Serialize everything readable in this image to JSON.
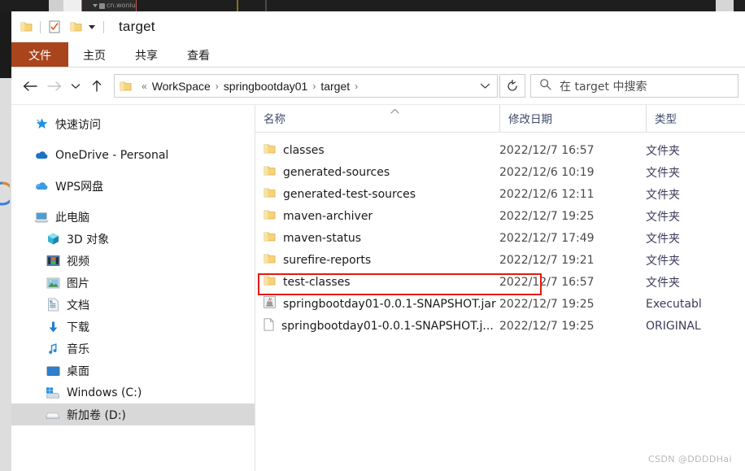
{
  "ide_background": {
    "tab_label": "cn.woniu",
    "tab_caret_icon": "chevron-down-icon",
    "package_icon": "package-icon",
    "bg_color": "#1e1e1e",
    "tab_border_color": "#c9534f",
    "accent_color": "#8a6d22"
  },
  "window": {
    "title": "target",
    "quick_access": {
      "folder_icon": "folder-icon",
      "properties_icon": "properties-checkbox-icon",
      "new_folder_icon": "new-folder-icon",
      "customize_icon": "chevron-down-icon"
    },
    "ribbon": {
      "tabs": [
        {
          "label": "文件",
          "active": true
        },
        {
          "label": "主页",
          "active": false
        },
        {
          "label": "共享",
          "active": false
        },
        {
          "label": "查看",
          "active": false
        }
      ],
      "file_tab_color": "#a9441c"
    },
    "navbar": {
      "back_icon": "arrow-left-icon",
      "forward_icon": "arrow-right-icon",
      "recent_icon": "chevron-down-icon",
      "up_icon": "arrow-up-icon",
      "address": {
        "folder_icon": "folder-icon",
        "overflow": "«",
        "crumbs": [
          "WorkSpace",
          "springbootday01",
          "target"
        ],
        "separator": "›",
        "dropdown_icon": "chevron-down-icon"
      },
      "refresh_icon": "refresh-icon",
      "search": {
        "icon": "search-icon",
        "placeholder": "在 target 中搜索",
        "value": ""
      }
    }
  },
  "sidebar": {
    "items": [
      {
        "label": "快速访问",
        "icon": "star-pin-icon",
        "indent": 0,
        "gap_top": false,
        "selected": false
      },
      {
        "label": "OneDrive - Personal",
        "icon": "onedrive-cloud-icon",
        "indent": 0,
        "gap_top": true,
        "selected": false
      },
      {
        "label": "WPS网盘",
        "icon": "wps-cloud-icon",
        "indent": 0,
        "gap_top": true,
        "selected": false
      },
      {
        "label": "此电脑",
        "icon": "this-pc-icon",
        "indent": 0,
        "gap_top": true,
        "selected": false
      },
      {
        "label": "3D 对象",
        "icon": "3d-objects-icon",
        "indent": 1,
        "gap_top": false,
        "selected": false
      },
      {
        "label": "视频",
        "icon": "videos-icon",
        "indent": 1,
        "gap_top": false,
        "selected": false
      },
      {
        "label": "图片",
        "icon": "pictures-icon",
        "indent": 1,
        "gap_top": false,
        "selected": false
      },
      {
        "label": "文档",
        "icon": "documents-icon",
        "indent": 1,
        "gap_top": false,
        "selected": false
      },
      {
        "label": "下载",
        "icon": "downloads-icon",
        "indent": 1,
        "gap_top": false,
        "selected": false
      },
      {
        "label": "音乐",
        "icon": "music-icon",
        "indent": 1,
        "gap_top": false,
        "selected": false
      },
      {
        "label": "桌面",
        "icon": "desktop-icon",
        "indent": 1,
        "gap_top": false,
        "selected": false
      },
      {
        "label": "Windows (C:)",
        "icon": "windows-drive-icon",
        "indent": 1,
        "gap_top": false,
        "selected": false
      },
      {
        "label": "新加卷 (D:)",
        "icon": "drive-icon",
        "indent": 1,
        "gap_top": false,
        "selected": true
      }
    ]
  },
  "filelist": {
    "columns": [
      {
        "label": "名称",
        "sorted": "asc",
        "sort_icon": "caret-up-icon"
      },
      {
        "label": "修改日期",
        "sorted": "",
        "sort_icon": ""
      },
      {
        "label": "类型",
        "sorted": "",
        "sort_icon": ""
      }
    ],
    "rows": [
      {
        "name": "classes",
        "date": "2022/12/7 16:57",
        "type": "文件夹",
        "icon": "folder-icon",
        "highlighted": false
      },
      {
        "name": "generated-sources",
        "date": "2022/12/6 10:19",
        "type": "文件夹",
        "icon": "folder-icon",
        "highlighted": false
      },
      {
        "name": "generated-test-sources",
        "date": "2022/12/6 12:11",
        "type": "文件夹",
        "icon": "folder-icon",
        "highlighted": false
      },
      {
        "name": "maven-archiver",
        "date": "2022/12/7 19:25",
        "type": "文件夹",
        "icon": "folder-icon",
        "highlighted": false
      },
      {
        "name": "maven-status",
        "date": "2022/12/7 17:49",
        "type": "文件夹",
        "icon": "folder-icon",
        "highlighted": false
      },
      {
        "name": "surefire-reports",
        "date": "2022/12/7 19:21",
        "type": "文件夹",
        "icon": "folder-icon",
        "highlighted": false
      },
      {
        "name": "test-classes",
        "date": "2022/12/7 16:57",
        "type": "文件夹",
        "icon": "folder-icon",
        "highlighted": false
      },
      {
        "name": "springbootday01-0.0.1-SNAPSHOT.jar",
        "date": "2022/12/7 19:25",
        "type": "Executabl",
        "icon": "java-jar-icon",
        "highlighted": true
      },
      {
        "name": "springbootday01-0.0.1-SNAPSHOT.j...",
        "date": "2022/12/7 19:25",
        "type": "ORIGINAL",
        "icon": "generic-file-icon",
        "highlighted": false
      }
    ],
    "annotation": {
      "color": "#e8180c",
      "target_row": 7
    }
  },
  "watermark": {
    "text": "CSDN @DDDDHai"
  }
}
